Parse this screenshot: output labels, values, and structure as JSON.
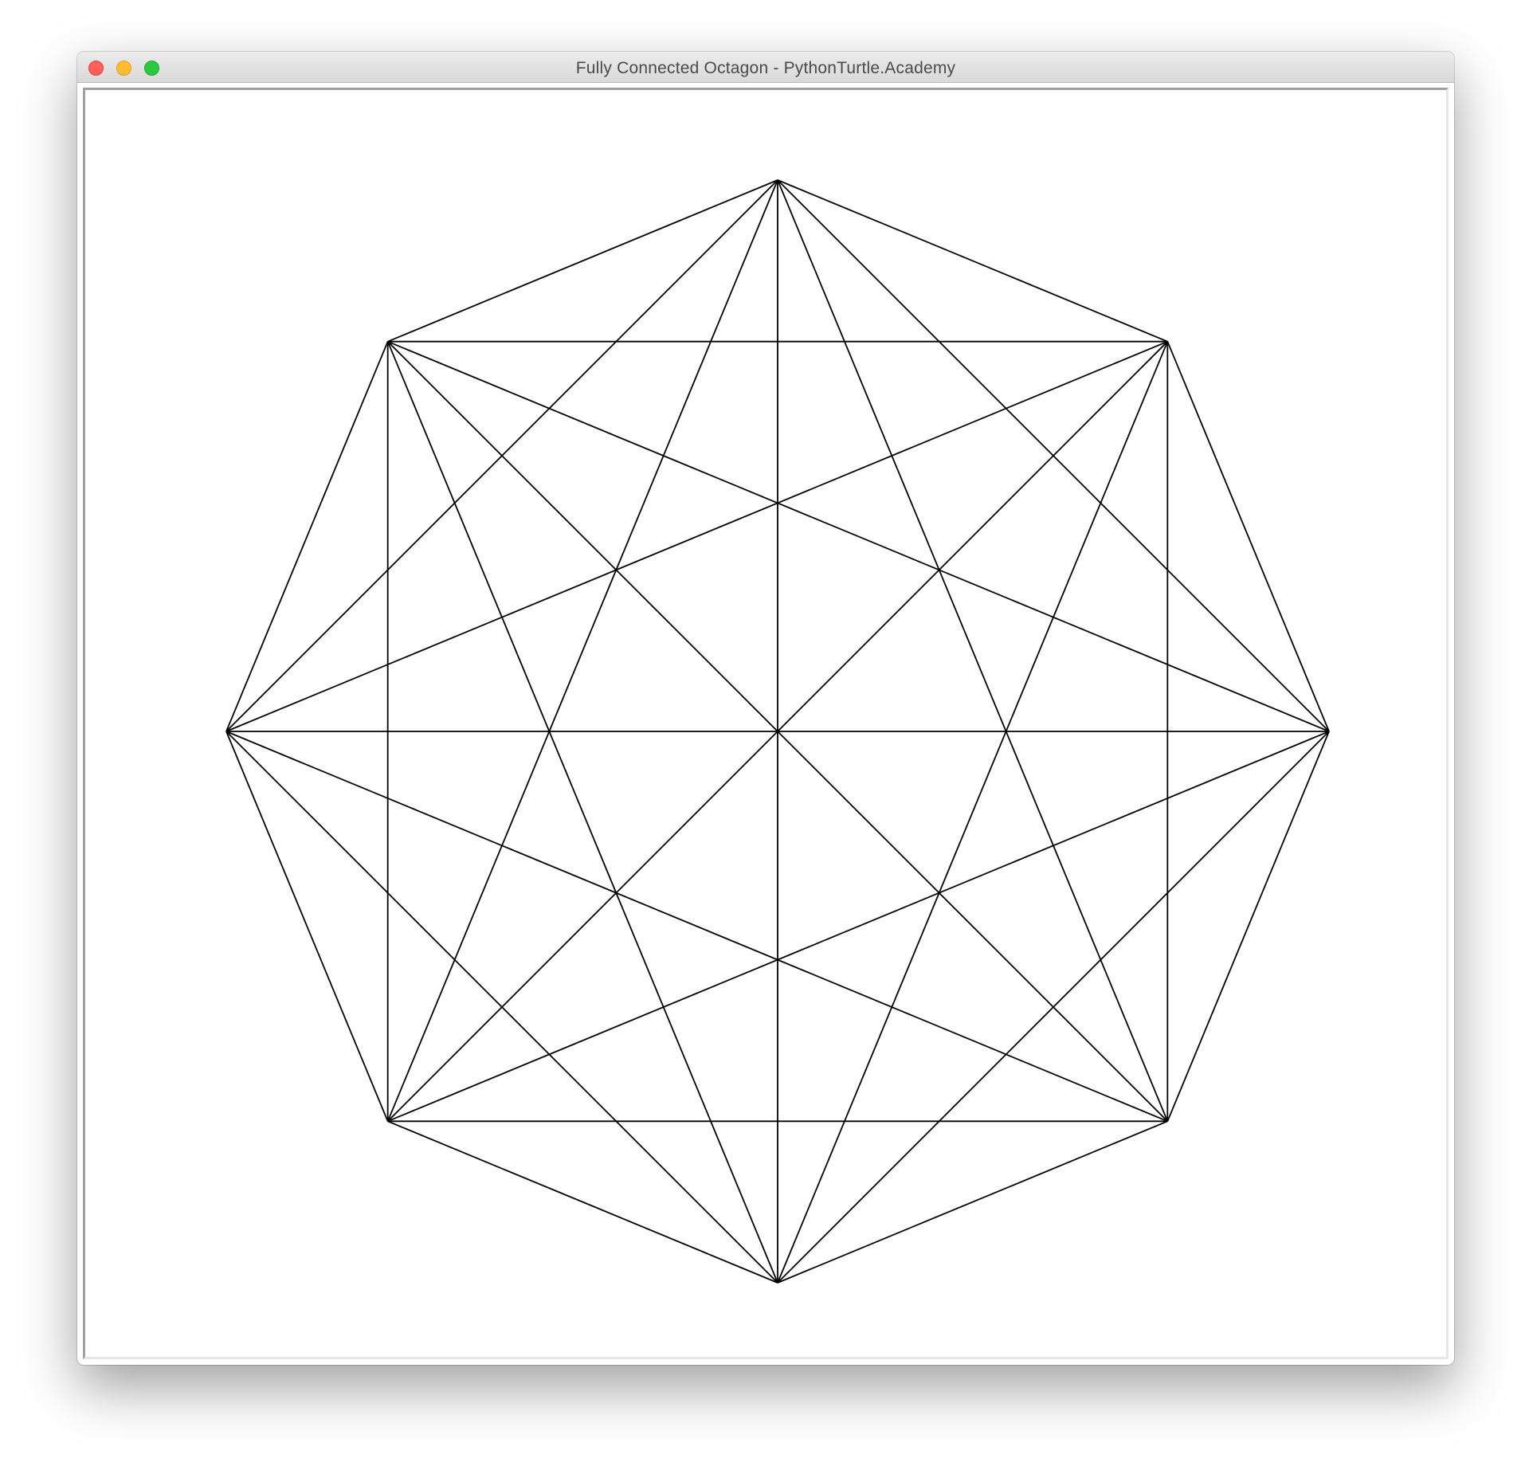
{
  "window": {
    "title": "Fully Connected Octagon - PythonTurtle.Academy",
    "controls": [
      {
        "name": "close-button",
        "color": "#fe5f57"
      },
      {
        "name": "minimize-button",
        "color": "#febc2e"
      },
      {
        "name": "maximize-button",
        "color": "#28c840"
      }
    ]
  },
  "canvas": {
    "background": "#ffffff",
    "line_color": "#000000",
    "shape": "octagon",
    "vertex_count": 8,
    "fully_connected": true
  }
}
